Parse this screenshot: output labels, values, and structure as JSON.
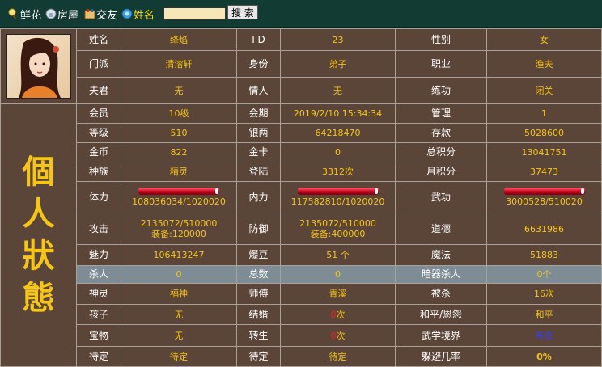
{
  "topbar": {
    "items": [
      {
        "label": "鲜花",
        "icon": "flower-icon"
      },
      {
        "label": "房屋",
        "icon": "house-icon"
      },
      {
        "label": "交友",
        "icon": "friends-icon"
      },
      {
        "label": "姓名",
        "icon": "search-icon"
      }
    ],
    "search_value": "",
    "search_button": "搜 索"
  },
  "profile": {
    "avatar": "avatar-portrait",
    "side_title": [
      "個",
      "人",
      "狀",
      "態"
    ]
  },
  "rows": [
    [
      "姓名",
      "绛焰",
      "I D",
      "23",
      "性别",
      "女"
    ],
    [
      "门派",
      "清溶轩",
      "身份",
      "弟子",
      "职业",
      "渔夫"
    ],
    [
      "夫君",
      "无",
      "情人",
      "无",
      "练功",
      "闭关"
    ],
    [
      "会员",
      "10级",
      "会期",
      "2019/2/10 15:34:34",
      "管理",
      "1"
    ],
    [
      "等级",
      "510",
      "银两",
      "64218470",
      "存款",
      "5028600"
    ],
    [
      "金币",
      "822",
      "金卡",
      "0",
      "总积分",
      "13041751"
    ],
    [
      "种族",
      "精灵",
      "登陆",
      "3312次",
      "月积分",
      "37473"
    ],
    [
      "体力",
      "108036034/1020020",
      "内力",
      "117582810/1020020",
      "武功",
      "3000528/510020"
    ],
    [
      "攻击",
      "2135072/510000|装备:120000",
      "防御",
      "2135072/510000|装备:400000",
      "道德",
      "6631986"
    ],
    [
      "魅力",
      "106413247",
      "爆豆",
      "51 个",
      "魔法",
      "51883"
    ],
    [
      "杀人",
      "0",
      "总数",
      "0",
      "暗器杀人",
      "0个"
    ],
    [
      "神灵",
      "福神",
      "师傅",
      "青溪",
      "被杀",
      "16次"
    ],
    [
      "孩子",
      "无",
      "结婚",
      "0次",
      "和平/恩怨",
      "和平"
    ],
    [
      "宝物",
      "无",
      "转生",
      "0次",
      "武学境界",
      "布衣"
    ],
    [
      "待定",
      "待定",
      "待定",
      "待定",
      "躲避几率",
      "0%"
    ]
  ],
  "colors": {
    "label": "#ffffff",
    "value": "#f5c518",
    "highlight_row": "#7d8c95",
    "rank_blue": "#3b3bff",
    "zero_red": "#ff1a1a"
  }
}
